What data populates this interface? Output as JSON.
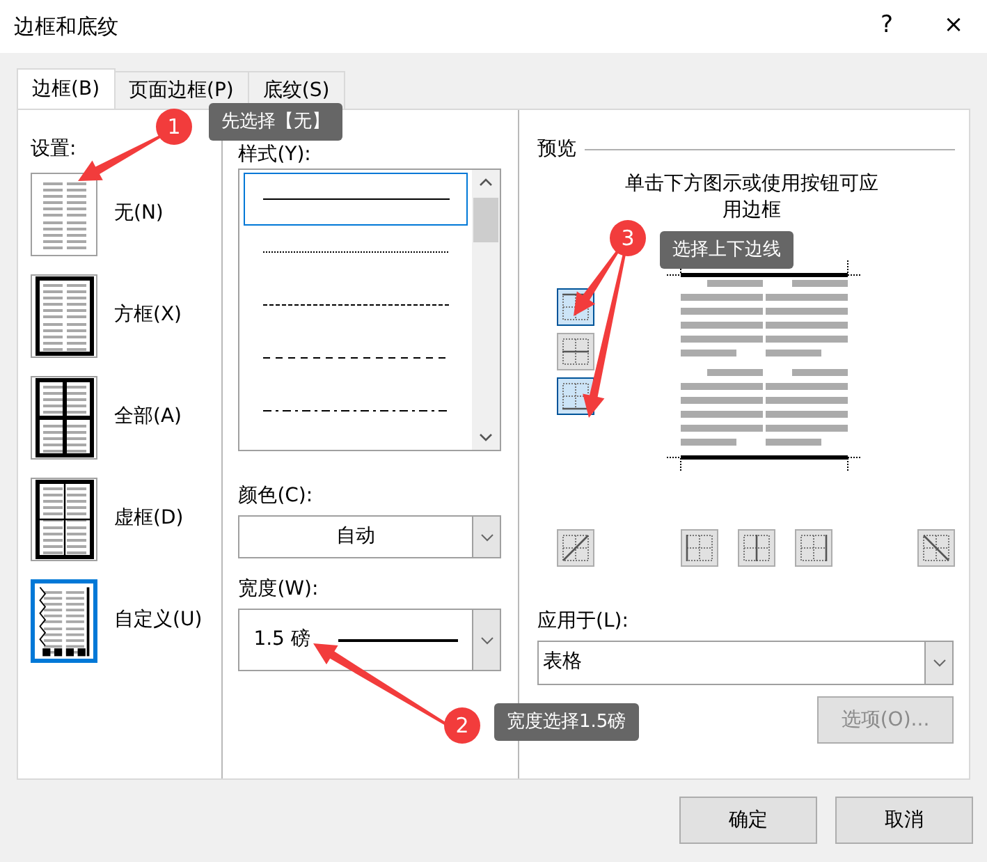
{
  "window": {
    "title": "边框和底纹",
    "help": "?",
    "close": "×"
  },
  "tabs": [
    {
      "label": "边框(B)",
      "selected": true
    },
    {
      "label": "页面边框(P)",
      "selected": false
    },
    {
      "label": "底纹(S)",
      "selected": false
    }
  ],
  "settings": {
    "label": "设置:",
    "items": [
      {
        "label": "无(N)",
        "kind": "none",
        "selected": false
      },
      {
        "label": "方框(X)",
        "kind": "box",
        "selected": false
      },
      {
        "label": "全部(A)",
        "kind": "all",
        "selected": false
      },
      {
        "label": "虚框(D)",
        "kind": "grid",
        "selected": false
      },
      {
        "label": "自定义(U)",
        "kind": "custom",
        "selected": true
      }
    ]
  },
  "style": {
    "label": "样式(Y):",
    "options": [
      {
        "kind": "solid",
        "selected": true
      },
      {
        "kind": "dotted",
        "selected": false
      },
      {
        "kind": "fine-dash",
        "selected": false
      },
      {
        "kind": "dash",
        "selected": false
      },
      {
        "kind": "dash-dot",
        "selected": false
      }
    ]
  },
  "color": {
    "label": "颜色(C):",
    "value": "自动"
  },
  "width": {
    "label": "宽度(W):",
    "value": "1.5 磅"
  },
  "preview": {
    "label": "预览",
    "hint": "单击下方图示或使用按钮可应用边框",
    "side_buttons": [
      {
        "kind": "top",
        "selected": true
      },
      {
        "kind": "middle",
        "selected": false
      },
      {
        "kind": "bottom",
        "selected": true
      }
    ],
    "bottom_buttons": [
      {
        "kind": "diag-up",
        "selected": false
      },
      {
        "kind": "left",
        "selected": false
      },
      {
        "kind": "center",
        "selected": false
      },
      {
        "kind": "right",
        "selected": false
      },
      {
        "kind": "diag-down",
        "selected": false
      }
    ]
  },
  "apply_to": {
    "label": "应用于(L):",
    "value": "表格"
  },
  "options_button": {
    "label": "选项(O)...",
    "disabled": true
  },
  "buttons": [
    "确定",
    "取消"
  ],
  "callouts": [
    {
      "number": "1",
      "text": "先选择【无】"
    },
    {
      "number": "2",
      "text": "宽度选择1.5磅"
    },
    {
      "number": "3",
      "text": "选择上下边线"
    }
  ]
}
